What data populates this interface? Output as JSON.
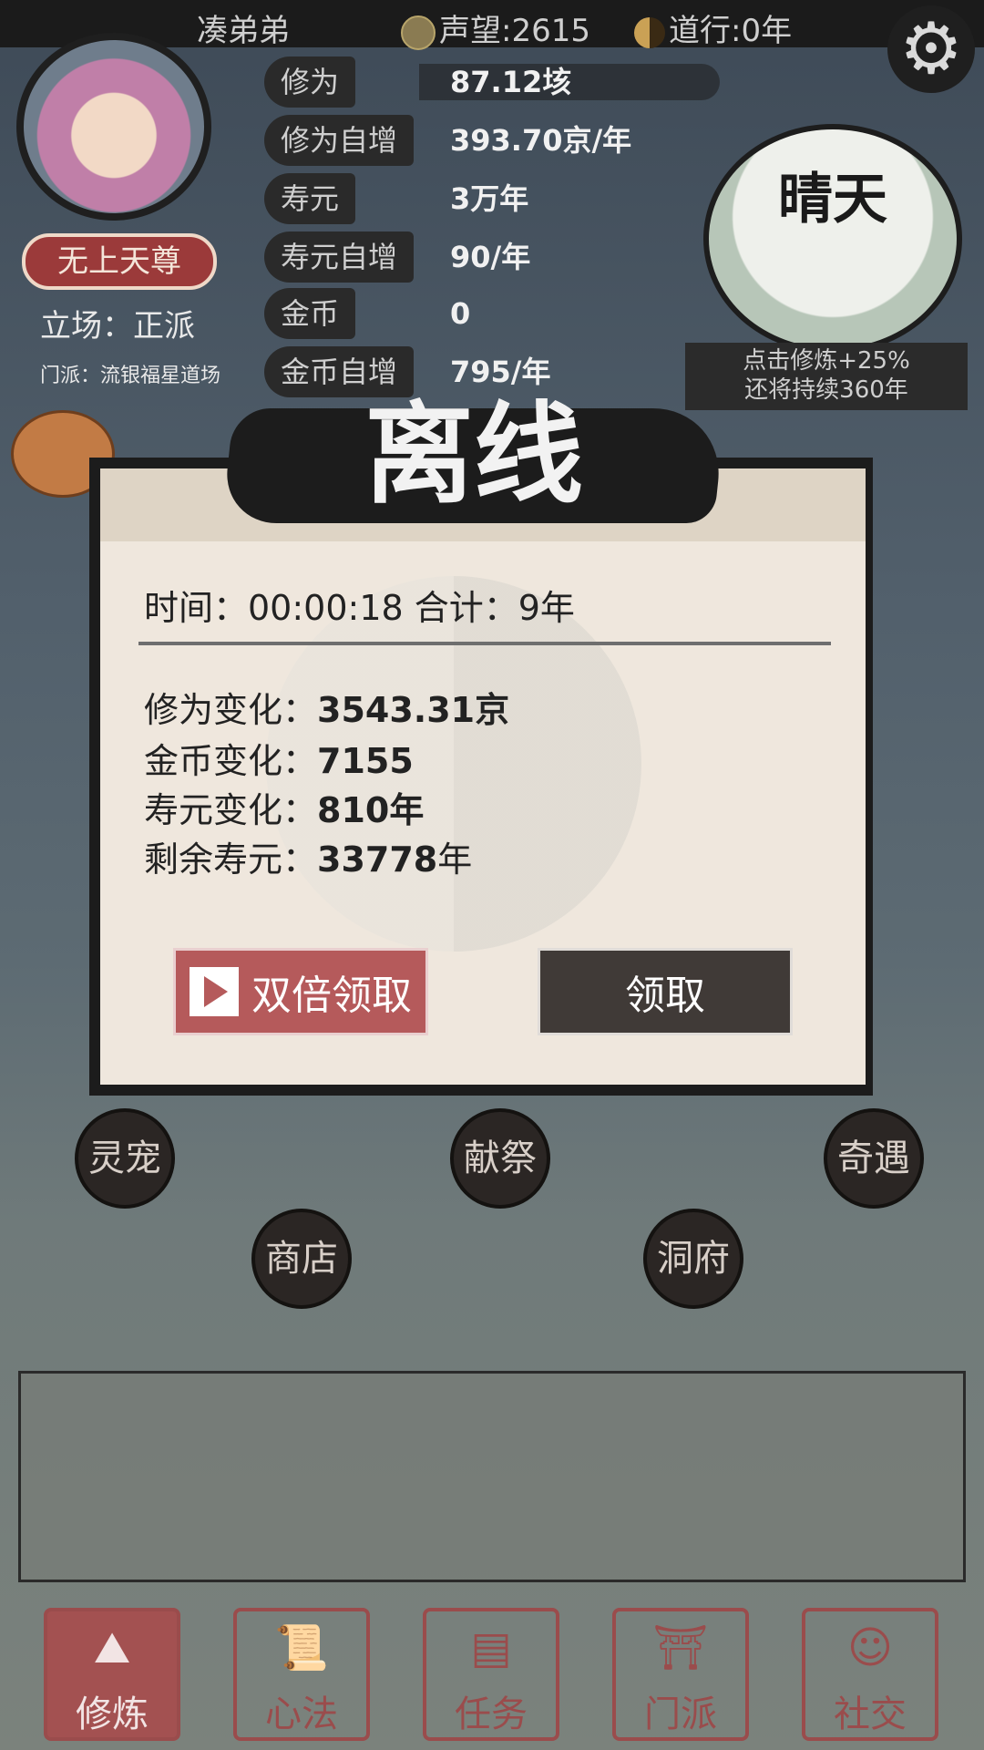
{
  "topbar": {
    "player_name": "凑弟弟",
    "reputation": "声望:2615",
    "daoxing": "道行:0年"
  },
  "profile": {
    "title_badge": "无上天尊",
    "stance": "立场：正派",
    "sect": "门派：流银福星道场"
  },
  "stats": [
    {
      "label": "修为",
      "value": "87.12垓"
    },
    {
      "label": "修为自增",
      "value": "393.70京/年"
    },
    {
      "label": "寿元",
      "value": "3万年"
    },
    {
      "label": "寿元自增",
      "value": "90/年"
    },
    {
      "label": "金币",
      "value": "0"
    },
    {
      "label": "金币自增",
      "value": "795/年"
    }
  ],
  "weather": {
    "name": "晴天",
    "info_line1": "点击修炼+25%",
    "info_line2": "还将持续360年"
  },
  "modal": {
    "title": "离线",
    "time_line": "时间：00:00:18  合计：9年",
    "rows": [
      {
        "label": "修为变化：",
        "value": "3543.31京"
      },
      {
        "label": "金币变化：",
        "value": "7155"
      },
      {
        "label": "寿元变化：",
        "value": "810年"
      },
      {
        "label": "剩余寿元：",
        "value": "33778",
        "suffix": "年"
      }
    ],
    "double_button": "双倍领取",
    "claim_button": "领取"
  },
  "map_buttons": [
    "灵宠",
    "献祭",
    "奇遇",
    "商店",
    "洞府"
  ],
  "bottom_nav": [
    "修炼",
    "心法",
    "任务",
    "门派",
    "社交"
  ],
  "colors": {
    "accent_red": "#b55a5b",
    "dark_button": "#403a37",
    "paper": "#efe7dd"
  }
}
